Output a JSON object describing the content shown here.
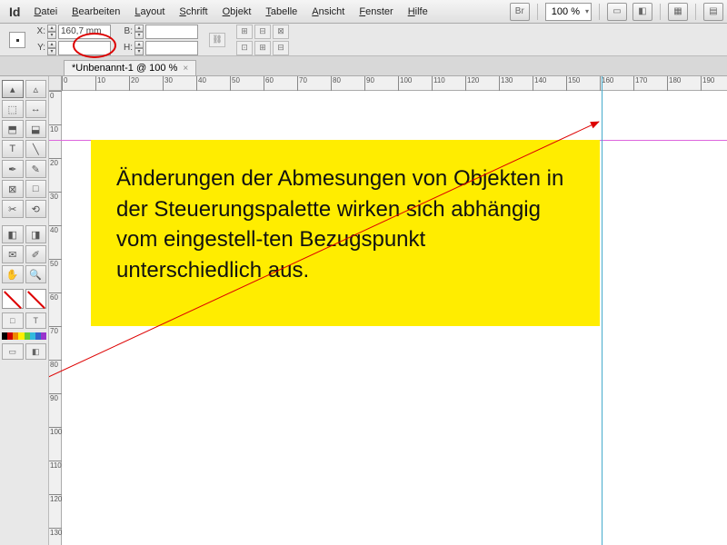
{
  "menu": {
    "items": [
      "Datei",
      "Bearbeiten",
      "Layout",
      "Schrift",
      "Objekt",
      "Tabelle",
      "Ansicht",
      "Fenster",
      "Hilfe"
    ],
    "br_label": "Br",
    "zoom": "100 %"
  },
  "control": {
    "x_label": "X:",
    "y_label": "Y:",
    "x_value": "160,7 mm",
    "y_value": "",
    "b_label": "B:",
    "h_label": "H:",
    "b_value": "",
    "h_value": ""
  },
  "tab": {
    "title": "*Unbenannt-1 @ 100 %"
  },
  "ruler_h": [
    "0",
    "10",
    "20",
    "30",
    "40",
    "50",
    "60",
    "70",
    "80",
    "90",
    "100",
    "110",
    "120",
    "130",
    "140",
    "150",
    "160",
    "170",
    "180",
    "190"
  ],
  "ruler_v": [
    "0",
    "10",
    "20",
    "30",
    "40",
    "50",
    "60",
    "70",
    "80",
    "90",
    "100",
    "110",
    "120",
    "130"
  ],
  "textbox": {
    "content": "Änderungen der Abmesungen von Objekten in der Steuerungspalette wirken sich abhängig vom eingestell-ten Bezugspunkt unterschiedlich aus."
  },
  "swatch_colors": [
    "#000",
    "#c00",
    "#e80",
    "#fe0",
    "#6c3",
    "#3bd",
    "#36c",
    "#93c"
  ]
}
